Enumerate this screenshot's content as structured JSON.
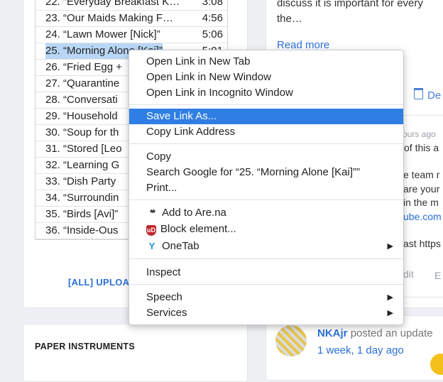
{
  "tracklist": {
    "rows": [
      {
        "title": "22. “Everyday Breakfast K…",
        "time": "3:08"
      },
      {
        "title": "23. “Our Maids Making F…",
        "time": "4:56"
      },
      {
        "title": "24. “Lawn Mower [Nick]”",
        "time": "5:06"
      },
      {
        "title": "25. “Morning Alone [Kai]”",
        "time": "5:01"
      },
      {
        "title": "26. “Fried Egg +",
        "time": ""
      },
      {
        "title": "27. “Quarantine",
        "time": ""
      },
      {
        "title": "28. “Conversati",
        "time": ""
      },
      {
        "title": "29. “Household",
        "time": ""
      },
      {
        "title": "30. “Soup for th",
        "time": ""
      },
      {
        "title": "31. “Stored [Leo",
        "time": ""
      },
      {
        "title": "32. “Learning G",
        "time": ""
      },
      {
        "title": "33. “Dish Party",
        "time": ""
      },
      {
        "title": "34. “Surroundin",
        "time": ""
      },
      {
        "title": "35. “Birds [Avi]”",
        "time": ""
      },
      {
        "title": "36. “Inside-Ous",
        "time": ""
      }
    ],
    "upload_link": "[ALL] UPLOA"
  },
  "paper_section": {
    "title": "PAPER INSTRUMENTS"
  },
  "feed": {
    "text": "discuss it is important for every the…",
    "read_more": "Read more",
    "delete_label": "De",
    "peek": {
      "ago": "ours ago",
      "of_this": "of this a",
      "team": "e team r",
      "are_your": "are your",
      "in_the": "in the m",
      "ube": "ube.com",
      "last": "ast https",
      "edit": "dit",
      "e": "E"
    },
    "post_author": "NKAjr",
    "post_action": "posted an update",
    "post_time": "1 week, 1 day ago"
  },
  "context_menu": {
    "items": [
      {
        "label": "Open Link in New Tab"
      },
      {
        "label": "Open Link in New Window"
      },
      {
        "label": "Open Link in Incognito Window"
      },
      {
        "label": "Save Link As..."
      },
      {
        "label": "Copy Link Address"
      },
      {
        "label": "Copy"
      },
      {
        "label": "Search Google for “25. “Morning Alone [Kai]””"
      },
      {
        "label": "Print..."
      },
      {
        "label": "Add to Are.na",
        "icon": "arena-icon"
      },
      {
        "label": "Block element...",
        "icon": "ublock-icon"
      },
      {
        "label": "OneTab",
        "icon": "onetab-icon"
      },
      {
        "label": "Inspect"
      },
      {
        "label": "Speech"
      },
      {
        "label": "Services"
      }
    ],
    "highlight_color": "#2f7ee3"
  }
}
